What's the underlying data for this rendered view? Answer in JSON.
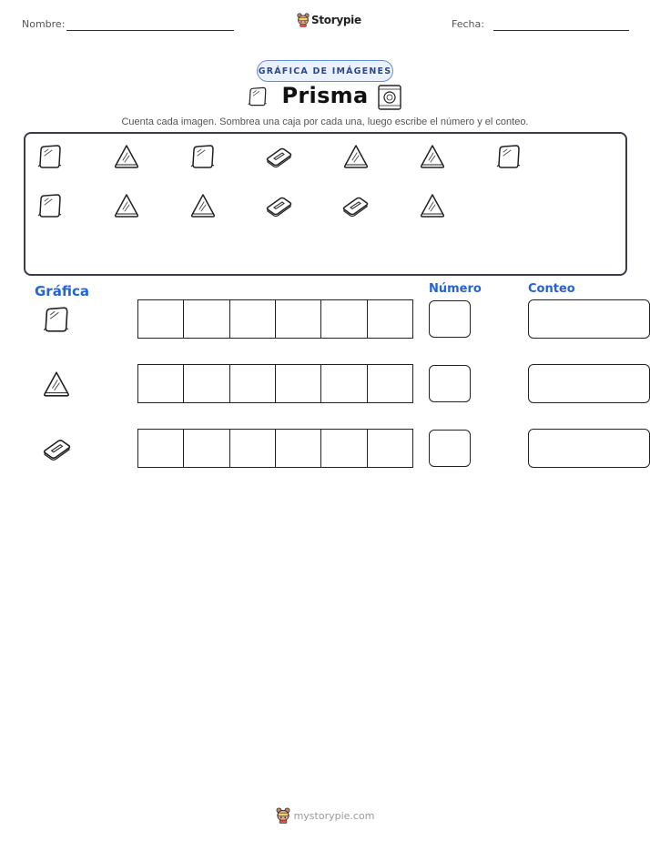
{
  "header": {
    "name_label": "Nombre:",
    "date_label": "Fecha:",
    "brand": "Storypie"
  },
  "badge": "GRÁFICA DE IMÁGENES",
  "title": "Prisma",
  "instructions": "Cuenta cada imagen. Sombrea una caja por cada una, luego escribe el número y el conteo.",
  "picture_box": {
    "rows": [
      [
        "trapezoid-prism-icon",
        "triangular-prism-icon",
        "trapezoid-prism-icon",
        "rectangular-prism-icon",
        "triangular-prism-icon",
        "triangular-prism-icon",
        "trapezoid-prism-icon"
      ],
      [
        "trapezoid-prism-icon",
        "triangular-prism-icon",
        "triangular-prism-icon",
        "rectangular-prism-icon",
        "rectangular-prism-icon",
        "triangular-prism-icon"
      ]
    ]
  },
  "graph": {
    "title": "Gráfica",
    "number_header": "Número",
    "count_header": "Conteo",
    "rows": [
      {
        "icon": "trapezoid-prism-icon",
        "boxes": 6
      },
      {
        "icon": "triangular-prism-icon",
        "boxes": 6
      },
      {
        "icon": "rectangular-prism-icon",
        "boxes": 6
      }
    ]
  },
  "footer": {
    "text": "mystorypie.com"
  },
  "colors": {
    "accent": "#2563d6",
    "badge_bg": "#eaf1fd",
    "badge_border": "#6b8fd6",
    "frame": "#3b3b4a"
  }
}
